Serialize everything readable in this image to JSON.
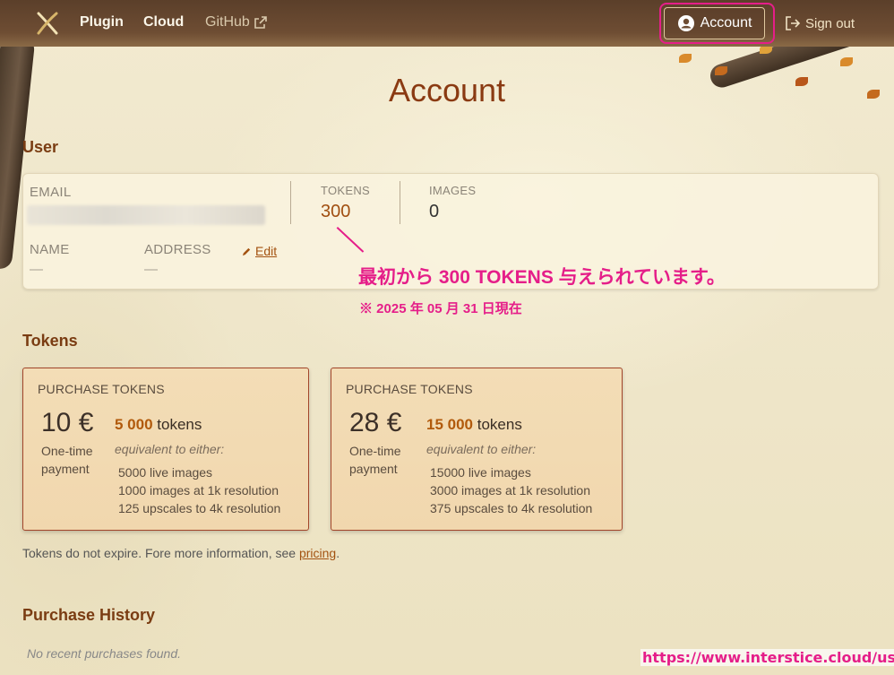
{
  "nav": {
    "items": [
      "Plugin",
      "Cloud",
      "GitHub"
    ],
    "account_label": "Account",
    "signout_label": "Sign out"
  },
  "page_title": "Account",
  "user_section": {
    "title": "User",
    "email_label": "EMAIL",
    "tokens_label": "TOKENS",
    "tokens_value": "300",
    "images_label": "IMAGES",
    "images_value": "0",
    "name_label": "NAME",
    "name_value": "—",
    "address_label": "ADDRESS",
    "address_value": "—",
    "edit_label": "Edit"
  },
  "annotation": {
    "main": "最初から 300 TOKENS 与えられています。",
    "sub": "※ 2025 年 05 月 31 日現在",
    "url": "https://www.interstice.cloud/user"
  },
  "tokens_section": {
    "title": "Tokens",
    "cards": [
      {
        "label": "PURCHASE TOKENS",
        "price": "10 €",
        "payment_line1": "One-time",
        "payment_line2": "payment",
        "amount": "5 000",
        "unit": "tokens",
        "equiv": "equivalent to either:",
        "items": [
          "5000 live images",
          "1000 images at 1k resolution",
          "125 upscales to 4k resolution"
        ]
      },
      {
        "label": "PURCHASE TOKENS",
        "price": "28 €",
        "payment_line1": "One-time",
        "payment_line2": "payment",
        "amount": "15 000",
        "unit": "tokens",
        "equiv": "equivalent to either:",
        "items": [
          "15000 live images",
          "3000 images at 1k resolution",
          "375 upscales to 4k resolution"
        ]
      }
    ],
    "note_prefix": "Tokens do not expire. Fore more information, see ",
    "note_link": "pricing",
    "note_suffix": "."
  },
  "history_section": {
    "title": "Purchase History",
    "empty": "No recent purchases found."
  }
}
